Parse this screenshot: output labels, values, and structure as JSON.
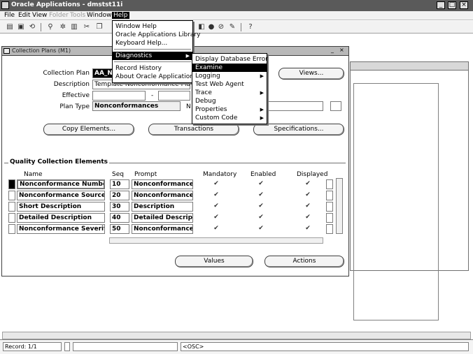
{
  "window": {
    "title": "Oracle Applications - dmstst11i",
    "min": "_",
    "max": "□",
    "close": "×"
  },
  "menubar": [
    "File",
    "Edit",
    "View",
    "Folder",
    "Tools",
    "Window",
    "Help"
  ],
  "toolbar_icons": [
    "open-icon",
    "save-icon",
    "refresh-icon",
    "find-icon",
    "zoom-icon",
    "print-icon",
    "cut-icon",
    "copy-icon",
    "clear-icon",
    "attach-icon",
    "folder-icon",
    "help-icon"
  ],
  "help_menu": {
    "items": [
      {
        "label": "Window Help",
        "submenu": false
      },
      {
        "label": "Oracle Applications Library",
        "submenu": false
      },
      {
        "label": "Keyboard Help...",
        "submenu": false
      },
      {
        "label": "Diagnostics",
        "submenu": true,
        "selected": true
      },
      {
        "label": "Record History",
        "submenu": false
      },
      {
        "label": "About Oracle Applications...",
        "submenu": false
      }
    ]
  },
  "diagnostics_menu": {
    "items": [
      {
        "label": "Display Database Error",
        "submenu": false
      },
      {
        "label": "Examine",
        "submenu": false,
        "selected": true
      },
      {
        "label": "Logging",
        "submenu": true
      },
      {
        "label": "Test Web Agent",
        "submenu": false
      },
      {
        "label": "Trace",
        "submenu": true
      },
      {
        "label": "Debug",
        "submenu": false
      },
      {
        "label": "Properties",
        "submenu": true
      },
      {
        "label": "Custom Code",
        "submenu": true
      }
    ]
  },
  "form": {
    "title": "Collection Plans (M1)",
    "labels": {
      "collection_plan": "Collection Plan",
      "description": "Description",
      "effective": "Effective",
      "plan_type": "Plan Type",
      "dash": "-",
      "n": "N"
    },
    "values": {
      "collection_plan": "AA_NC",
      "description": "Template Nonconformance Plan",
      "effective_from": "",
      "effective_to": "",
      "plan_type": "Nonconformances"
    },
    "buttons": {
      "views": "Views...",
      "copy_elements": "Copy Elements...",
      "transactions": "Transactions",
      "specifications": "Specifications...",
      "values": "Values",
      "actions": "Actions"
    },
    "section_title": "Quality Collection Elements",
    "columns": {
      "name": "Name",
      "seq": "Seq",
      "prompt": "Prompt",
      "mandatory": "Mandatory",
      "enabled": "Enabled",
      "displayed": "Displayed"
    },
    "rows": [
      {
        "name": "Nonconformance Number",
        "seq": "10",
        "prompt": "Nonconformance Nu",
        "mandatory": "✔",
        "enabled": "✔",
        "displayed": "✔"
      },
      {
        "name": "Nonconformance Source",
        "seq": "20",
        "prompt": "Nonconformance So",
        "mandatory": "✔",
        "enabled": "✔",
        "displayed": "✔"
      },
      {
        "name": "Short Description",
        "seq": "30",
        "prompt": "Description",
        "mandatory": "✔",
        "enabled": "✔",
        "displayed": "✔"
      },
      {
        "name": "Detailed Description",
        "seq": "40",
        "prompt": "Detailed Description",
        "mandatory": "✔",
        "enabled": "✔",
        "displayed": "✔"
      },
      {
        "name": "Nonconformance Severity",
        "seq": "50",
        "prompt": "Nonconformance Severity",
        "mandatory": "✔",
        "enabled": "✔",
        "displayed": "✔"
      }
    ]
  },
  "statusbar": {
    "record": "Record: 1/1",
    "mode": "<OSC>"
  }
}
